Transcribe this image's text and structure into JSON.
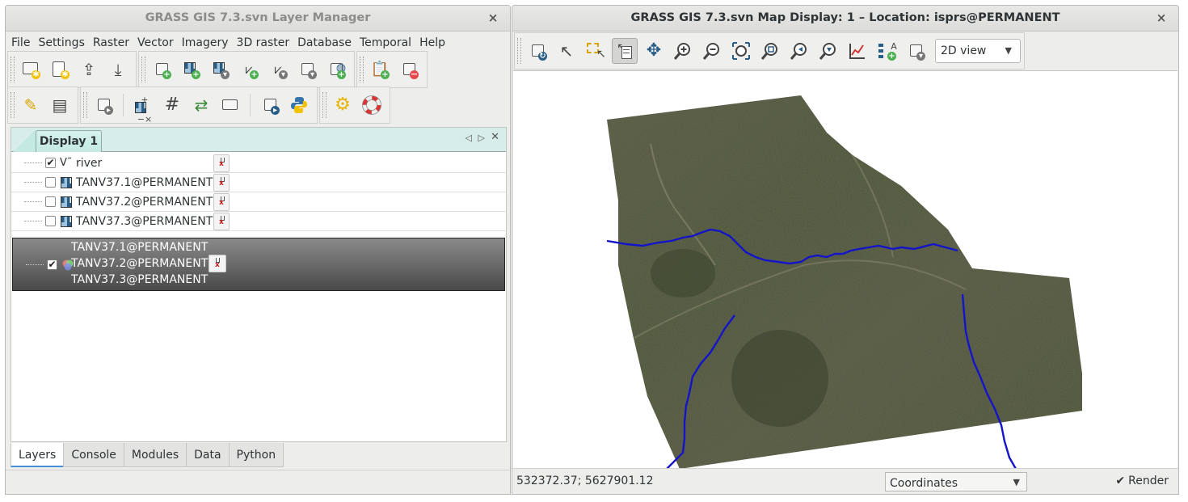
{
  "layer_manager": {
    "title": "GRASS GIS 7.3.svn Layer Manager",
    "close": "×",
    "menu": [
      "File",
      "Settings",
      "Raster",
      "Vector",
      "Imagery",
      "3D raster",
      "Database",
      "Temporal",
      "Help"
    ],
    "display_tab": "Display 1",
    "layers": [
      {
        "name": "river",
        "checked": true,
        "type": "vector"
      },
      {
        "name": "TANV37.1@PERMANENT",
        "checked": false,
        "type": "raster"
      },
      {
        "name": "TANV37.2@PERMANENT",
        "checked": false,
        "type": "raster"
      },
      {
        "name": "TANV37.3@PERMANENT",
        "checked": false,
        "type": "raster"
      }
    ],
    "rgb_layer": {
      "checked": true,
      "lines": [
        "TANV37.1@PERMANENT",
        "TANV37.2@PERMANENT",
        "TANV37.3@PERMANENT"
      ]
    },
    "bottom_tabs": [
      "Layers",
      "Console",
      "Modules",
      "Data",
      "Python"
    ],
    "active_tab": "Layers"
  },
  "map_display": {
    "title": "GRASS GIS 7.3.svn Map Display: 1 – Location: isprs@PERMANENT",
    "close": "×",
    "view_mode": "2D view",
    "coordinates": "532372.37; 5627901.12",
    "status_mode": "Coordinates",
    "render_label": "Render",
    "render_checked": true,
    "colors": {
      "river": "#1414c8"
    }
  }
}
